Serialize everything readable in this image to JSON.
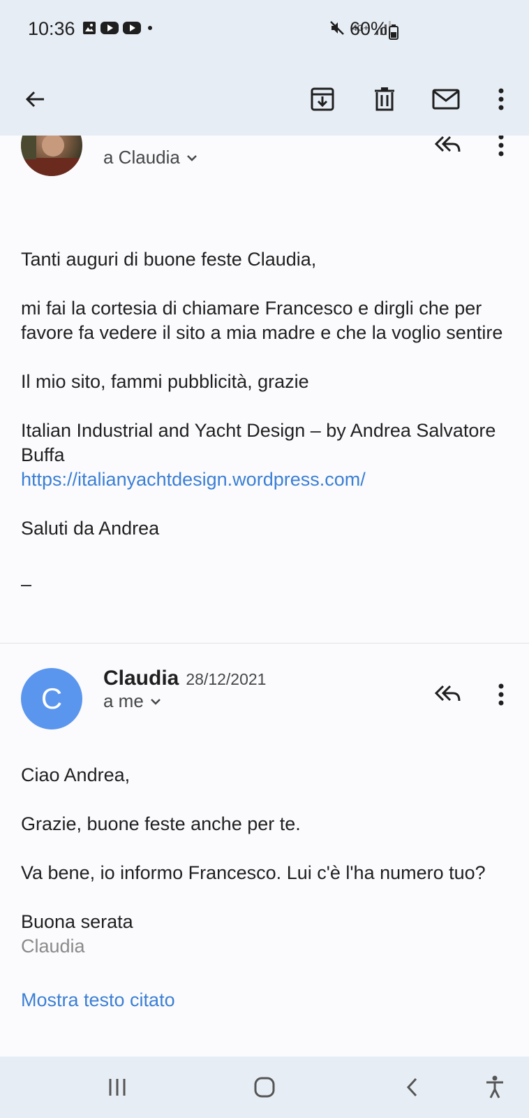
{
  "status_bar": {
    "time": "10:36",
    "network": "4G+",
    "battery": "60%",
    "left_icons": [
      "gallery-icon",
      "youtube-icon",
      "youtube-icon",
      "dot-icon"
    ],
    "right_icons": [
      "mute-icon",
      "network-4g-icon",
      "signal-icon"
    ]
  },
  "toolbar": {
    "actions": [
      "back-icon",
      "archive-icon",
      "delete-icon",
      "mark-unread-icon",
      "more-icon"
    ]
  },
  "message_1": {
    "recipient": "a Claudia",
    "body": {
      "greeting": "Tanti auguri di buone feste Claudia,",
      "paragraph": "mi fai la cortesia di chiamare Francesco e dirgli che per favore fa vedere il sito a mia madre e che la voglio sentire",
      "site_line": "Il mio sito, fammi pubblicità, grazie",
      "site_title": "Italian Industrial and Yacht Design – by Andrea Salvatore Buffa",
      "site_link": "https://italianyachtdesign.wordpress.com/",
      "closing": "Saluti da Andrea",
      "signature_sep": "–"
    }
  },
  "message_2": {
    "avatar_letter": "C",
    "avatar_color": "#5b96ee",
    "sender": "Claudia",
    "date": "28/12/2021",
    "recipient": "a me",
    "body": {
      "greeting": "Ciao Andrea,",
      "line1": "Grazie, buone feste anche per te.",
      "line2": "Va bene, io informo Francesco. Lui c'è l'ha numero tuo?",
      "closing": "Buona serata",
      "signature": "Claudia",
      "show_quoted": "Mostra testo citato"
    }
  },
  "colors": {
    "header_bg": "#e7edf5",
    "link": "#3b7fd4"
  }
}
